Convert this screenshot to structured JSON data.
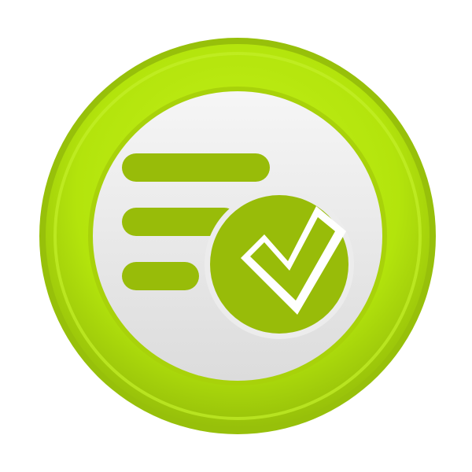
{
  "icon": {
    "name": "task-list-check-icon",
    "colors": {
      "background": "#ffffff",
      "ring_outer": "#97c00a",
      "ring_mid": "#b3e40c",
      "ring_inner": "#a8d20a",
      "face_light": "#f6f6f6",
      "face_dark": "#dcdcdc",
      "symbol": "#98bc09",
      "check_white": "#ffffff"
    }
  }
}
